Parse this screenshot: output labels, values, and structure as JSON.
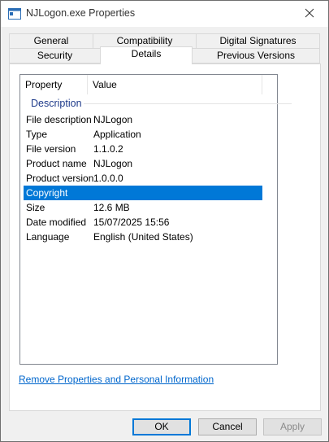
{
  "window": {
    "title": "NJLogon.exe Properties",
    "icon": "application-window-icon",
    "close_icon": "close-icon"
  },
  "tabs": {
    "row_back": [
      {
        "label": "General"
      },
      {
        "label": "Compatibility"
      },
      {
        "label": "Digital Signatures"
      }
    ],
    "row_front": [
      {
        "label": "Security"
      },
      {
        "label": "Details",
        "active": true
      },
      {
        "label": "Previous Versions"
      }
    ]
  },
  "details": {
    "columns": {
      "property": "Property",
      "value": "Value"
    },
    "group": "Description",
    "rows": [
      {
        "property": "File description",
        "value": "NJLogon"
      },
      {
        "property": "Type",
        "value": "Application"
      },
      {
        "property": "File version",
        "value": "1.1.0.2"
      },
      {
        "property": "Product name",
        "value": "NJLogon"
      },
      {
        "property": "Product version",
        "value": "1.0.0.0"
      },
      {
        "property": "Copyright",
        "value": "",
        "selected": true
      },
      {
        "property": "Size",
        "value": "12.6 MB"
      },
      {
        "property": "Date modified",
        "value": "15/07/2025 15:56"
      },
      {
        "property": "Language",
        "value": "English (United States)"
      }
    ]
  },
  "links": {
    "remove_properties": "Remove Properties and Personal Information"
  },
  "buttons": {
    "ok": "OK",
    "cancel": "Cancel",
    "apply": "Apply"
  },
  "colors": {
    "selection": "#0078d7",
    "group_header": "#1e3a8a",
    "link": "#0066cc"
  }
}
